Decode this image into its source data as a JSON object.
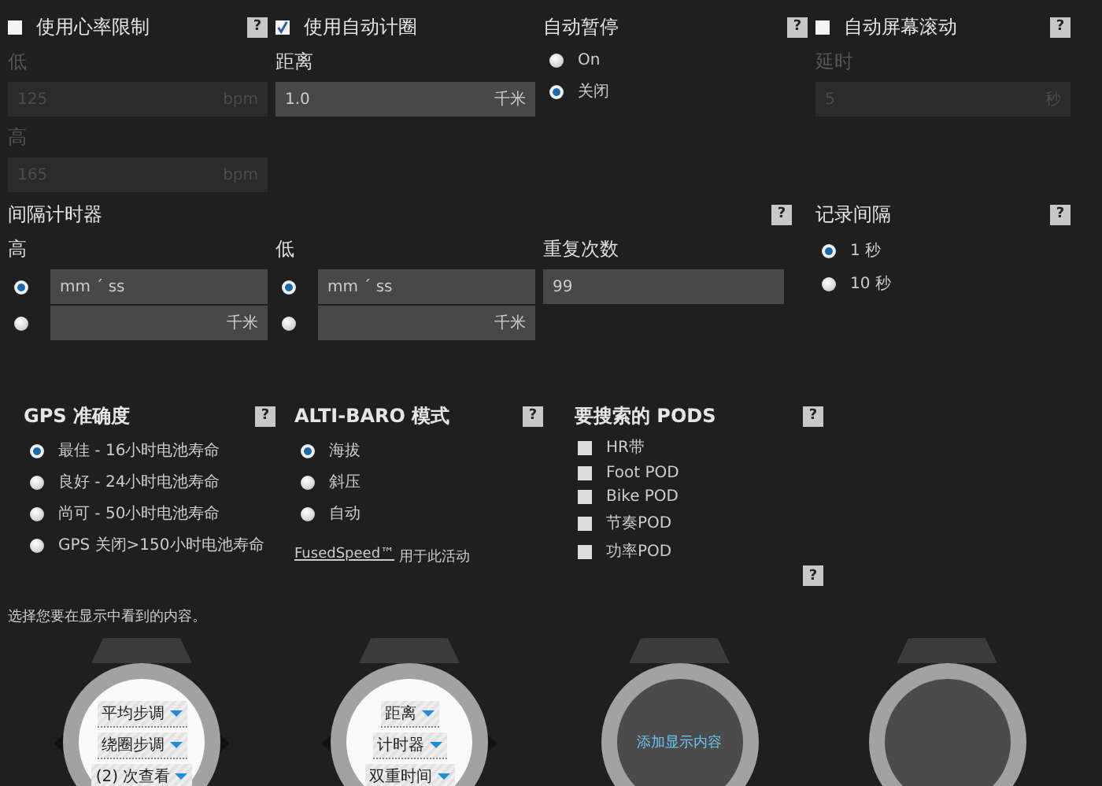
{
  "heart_rate_limits": {
    "label": "使用心率限制",
    "checked": false,
    "help": "?",
    "low_label": "低",
    "low": {
      "value": "125",
      "unit": "bpm"
    },
    "high_label": "高",
    "high": {
      "value": "165",
      "unit": "bpm"
    }
  },
  "auto_lap": {
    "label": "使用自动计圈",
    "checked": true,
    "distance_label": "距离",
    "distance": {
      "value": "1.0",
      "unit": "千米"
    }
  },
  "auto_pause": {
    "title": "自动暂停",
    "help": "?",
    "options": [
      {
        "label": "On",
        "selected": false
      },
      {
        "label": "关闭",
        "selected": true
      }
    ]
  },
  "auto_scroll": {
    "label": "自动屏幕滚动",
    "checked": false,
    "help": "?",
    "delay_label": "延时",
    "delay": {
      "value": "5",
      "unit": "秒"
    }
  },
  "interval_timer": {
    "title": "间隔计时器",
    "help": "?",
    "groups": [
      {
        "label": "高",
        "rows": [
          {
            "kind": "time",
            "value": "mm ˊ ss",
            "selected": true
          },
          {
            "kind": "distance",
            "unit": "千米",
            "selected": false
          }
        ]
      },
      {
        "label": "低",
        "rows": [
          {
            "kind": "time",
            "value": "mm ˊ ss",
            "selected": true
          },
          {
            "kind": "distance",
            "unit": "千米",
            "selected": false
          }
        ]
      }
    ],
    "repeats_label": "重复次数",
    "repeats": "99"
  },
  "record_interval": {
    "title": "记录间隔",
    "help": "?",
    "options": [
      {
        "label": "1 秒",
        "selected": true
      },
      {
        "label": "10 秒",
        "selected": false
      }
    ]
  },
  "gps_accuracy": {
    "title": "GPS 准确度",
    "help": "?",
    "options": [
      {
        "label": "最佳 - 16小时电池寿命",
        "selected": true
      },
      {
        "label": "良好 - 24小时电池寿命",
        "selected": false
      },
      {
        "label": "尚可 - 50小时电池寿命",
        "selected": false
      },
      {
        "label": "GPS 关闭>150小时电池寿命",
        "selected": false
      }
    ]
  },
  "alti_baro": {
    "title": "ALTI-BARO 模式",
    "help": "?",
    "options": [
      {
        "label": "海拔",
        "selected": true
      },
      {
        "label": "斜压",
        "selected": false
      },
      {
        "label": "自动",
        "selected": false
      }
    ],
    "link": "FusedSpeed™",
    "link_note": "用于此活动"
  },
  "pods": {
    "title": "要搜索的 PODS",
    "help": "?",
    "items": [
      {
        "label": "HR带",
        "checked": false
      },
      {
        "label": "Foot POD",
        "checked": false
      },
      {
        "label": "Bike POD",
        "checked": false
      },
      {
        "label": "节奏POD",
        "checked": false
      },
      {
        "label": "功率POD",
        "checked": false
      }
    ],
    "help_bottom": "?"
  },
  "display": {
    "prompt": "选择您要在显示中看到的内容。",
    "watches": [
      {
        "kind": "fields",
        "fields": [
          "平均步调",
          "绕圈步调",
          "(2) 次查看"
        ]
      },
      {
        "kind": "fields",
        "fields": [
          "距离",
          "计时器",
          "双重时间"
        ]
      },
      {
        "kind": "add",
        "label": "添加显示内容"
      },
      {
        "kind": "empty"
      }
    ]
  }
}
